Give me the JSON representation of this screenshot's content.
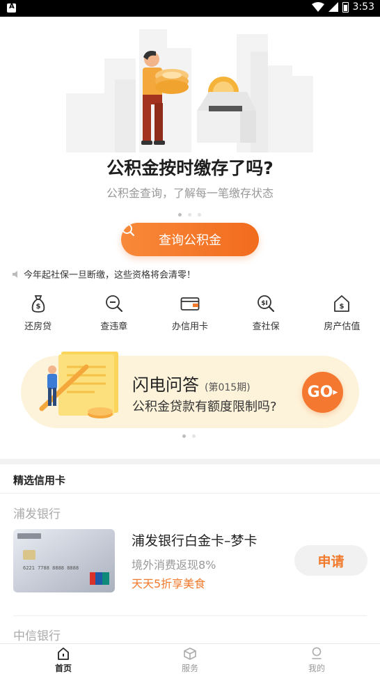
{
  "status_bar": {
    "time": "3:53"
  },
  "hero": {
    "title": "公积金按时缴存了吗?",
    "subtitle": "公积金查询，了解每一笔缴存状态",
    "button_label": "查询公积金"
  },
  "notice": {
    "text": "今年起社保一旦断缴，这些资格将会清零！"
  },
  "actions": [
    {
      "label": "还房贷",
      "icon": "money-bag-icon"
    },
    {
      "label": "查违章",
      "icon": "search-minus-icon"
    },
    {
      "label": "办信用卡",
      "icon": "wallet-card-icon"
    },
    {
      "label": "查社保",
      "icon": "social-security-search-icon"
    },
    {
      "label": "房产估值",
      "icon": "house-dollar-icon"
    }
  ],
  "banner": {
    "title": "闪电问答",
    "issue": "(第015期)",
    "question": "公积金贷款有额度限制吗?",
    "go_label": "GO"
  },
  "credit_cards": {
    "section_title": "精选信用卡",
    "banks": [
      {
        "bank": "浦发银行",
        "card_name": "浦发银行白金卡–梦卡",
        "feature_1": "境外消费返现8%",
        "feature_2": "天天5折享美食",
        "apply_label": "申请"
      },
      {
        "bank": "中信银行"
      }
    ]
  },
  "tabbar": [
    {
      "label": "首页",
      "icon": "home-icon",
      "active": true
    },
    {
      "label": "服务",
      "icon": "cube-icon",
      "active": false
    },
    {
      "label": "我的",
      "icon": "user-icon",
      "active": false
    }
  ],
  "colors": {
    "accent": "#F27A2C",
    "banner_bg": "#FDF3DA",
    "text": "#222222",
    "muted": "#999999"
  }
}
